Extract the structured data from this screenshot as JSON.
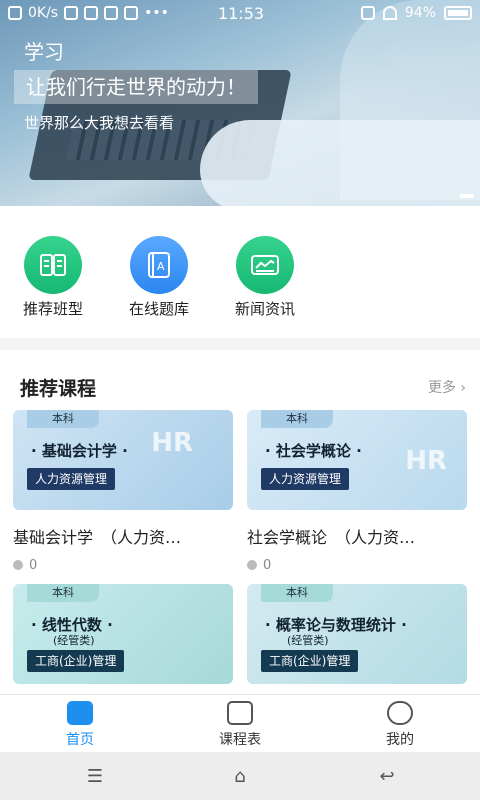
{
  "status_bar": {
    "speed": "0K/s",
    "time": "11:53",
    "battery": "94%"
  },
  "banner": {
    "title": "学习",
    "slogan": "让我们行走世界的动力！",
    "subtitle": "世界那么大我想去看看"
  },
  "quick_menu": [
    {
      "label": "推荐班型",
      "icon": "book-icon"
    },
    {
      "label": "在线题库",
      "icon": "question-bank-icon"
    },
    {
      "label": "新闻资讯",
      "icon": "news-icon"
    }
  ],
  "courses_section": {
    "title": "推荐课程",
    "more": "更多 ›",
    "cards": [
      {
        "tag": "本科",
        "title": "· 基础会计学 ·",
        "subtitle": "",
        "badge": "人力资源管理",
        "deco": "HR",
        "name": "基础会计学　（人力资…",
        "count": "0"
      },
      {
        "tag": "本科",
        "title": "· 社会学概论 ·",
        "subtitle": "",
        "badge": "人力资源管理",
        "deco": "HR",
        "name": "社会学概论　（人力资…",
        "count": "0"
      },
      {
        "tag": "本科",
        "title": "· 线性代数 ·",
        "subtitle": "(经管类)",
        "badge": "工商(企业)管理",
        "deco": "",
        "name": "",
        "count": ""
      },
      {
        "tag": "本科",
        "title": "· 概率论与数理统计 ·",
        "subtitle": "(经管类)",
        "badge": "工商(企业)管理",
        "deco": "",
        "name": "",
        "count": ""
      }
    ]
  },
  "tab_bar": [
    {
      "label": "首页",
      "active": true
    },
    {
      "label": "课程表",
      "active": false
    },
    {
      "label": "我的",
      "active": false
    }
  ],
  "colors": {
    "accent": "#1e8ef0",
    "green": "#16b874",
    "blue": "#2a86f0"
  }
}
